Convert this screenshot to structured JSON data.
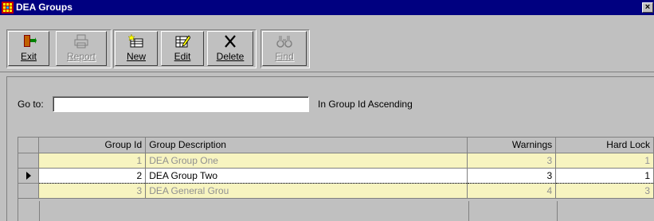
{
  "window": {
    "title": "DEA Groups",
    "icon": "app-grid-icon",
    "close_label": "×"
  },
  "toolbar": {
    "buttons": [
      {
        "label": "Exit",
        "icon": "exit-door-icon",
        "enabled": true
      },
      {
        "label": "Report",
        "icon": "printer-icon",
        "enabled": false
      },
      {
        "label": "New",
        "icon": "new-record-icon",
        "enabled": true
      },
      {
        "label": "Edit",
        "icon": "edit-record-icon",
        "enabled": true
      },
      {
        "label": "Delete",
        "icon": "delete-x-icon",
        "enabled": true
      },
      {
        "label": "Find",
        "icon": "binoculars-icon",
        "enabled": false
      }
    ]
  },
  "goto": {
    "label": "Go to:",
    "value": "",
    "sort_text": "In Group Id Ascending"
  },
  "grid": {
    "columns": [
      "Group Id",
      "Group Description",
      "Warnings",
      "Hard Lock"
    ],
    "rows": [
      {
        "group_id": "1",
        "description": "DEA Group One",
        "warnings": "3",
        "hard_lock": "1",
        "current": false
      },
      {
        "group_id": "2",
        "description": "DEA Group Two",
        "warnings": "3",
        "hard_lock": "1",
        "current": true
      },
      {
        "group_id": "3",
        "description": "DEA General Grou",
        "warnings": "4",
        "hard_lock": "3",
        "current": false
      }
    ],
    "colors": {
      "row_highlight": "#f4f0b0",
      "current_row": "#ffffff"
    }
  },
  "colors": {
    "titlebar": "#000080",
    "face": "#c0c0c0"
  }
}
